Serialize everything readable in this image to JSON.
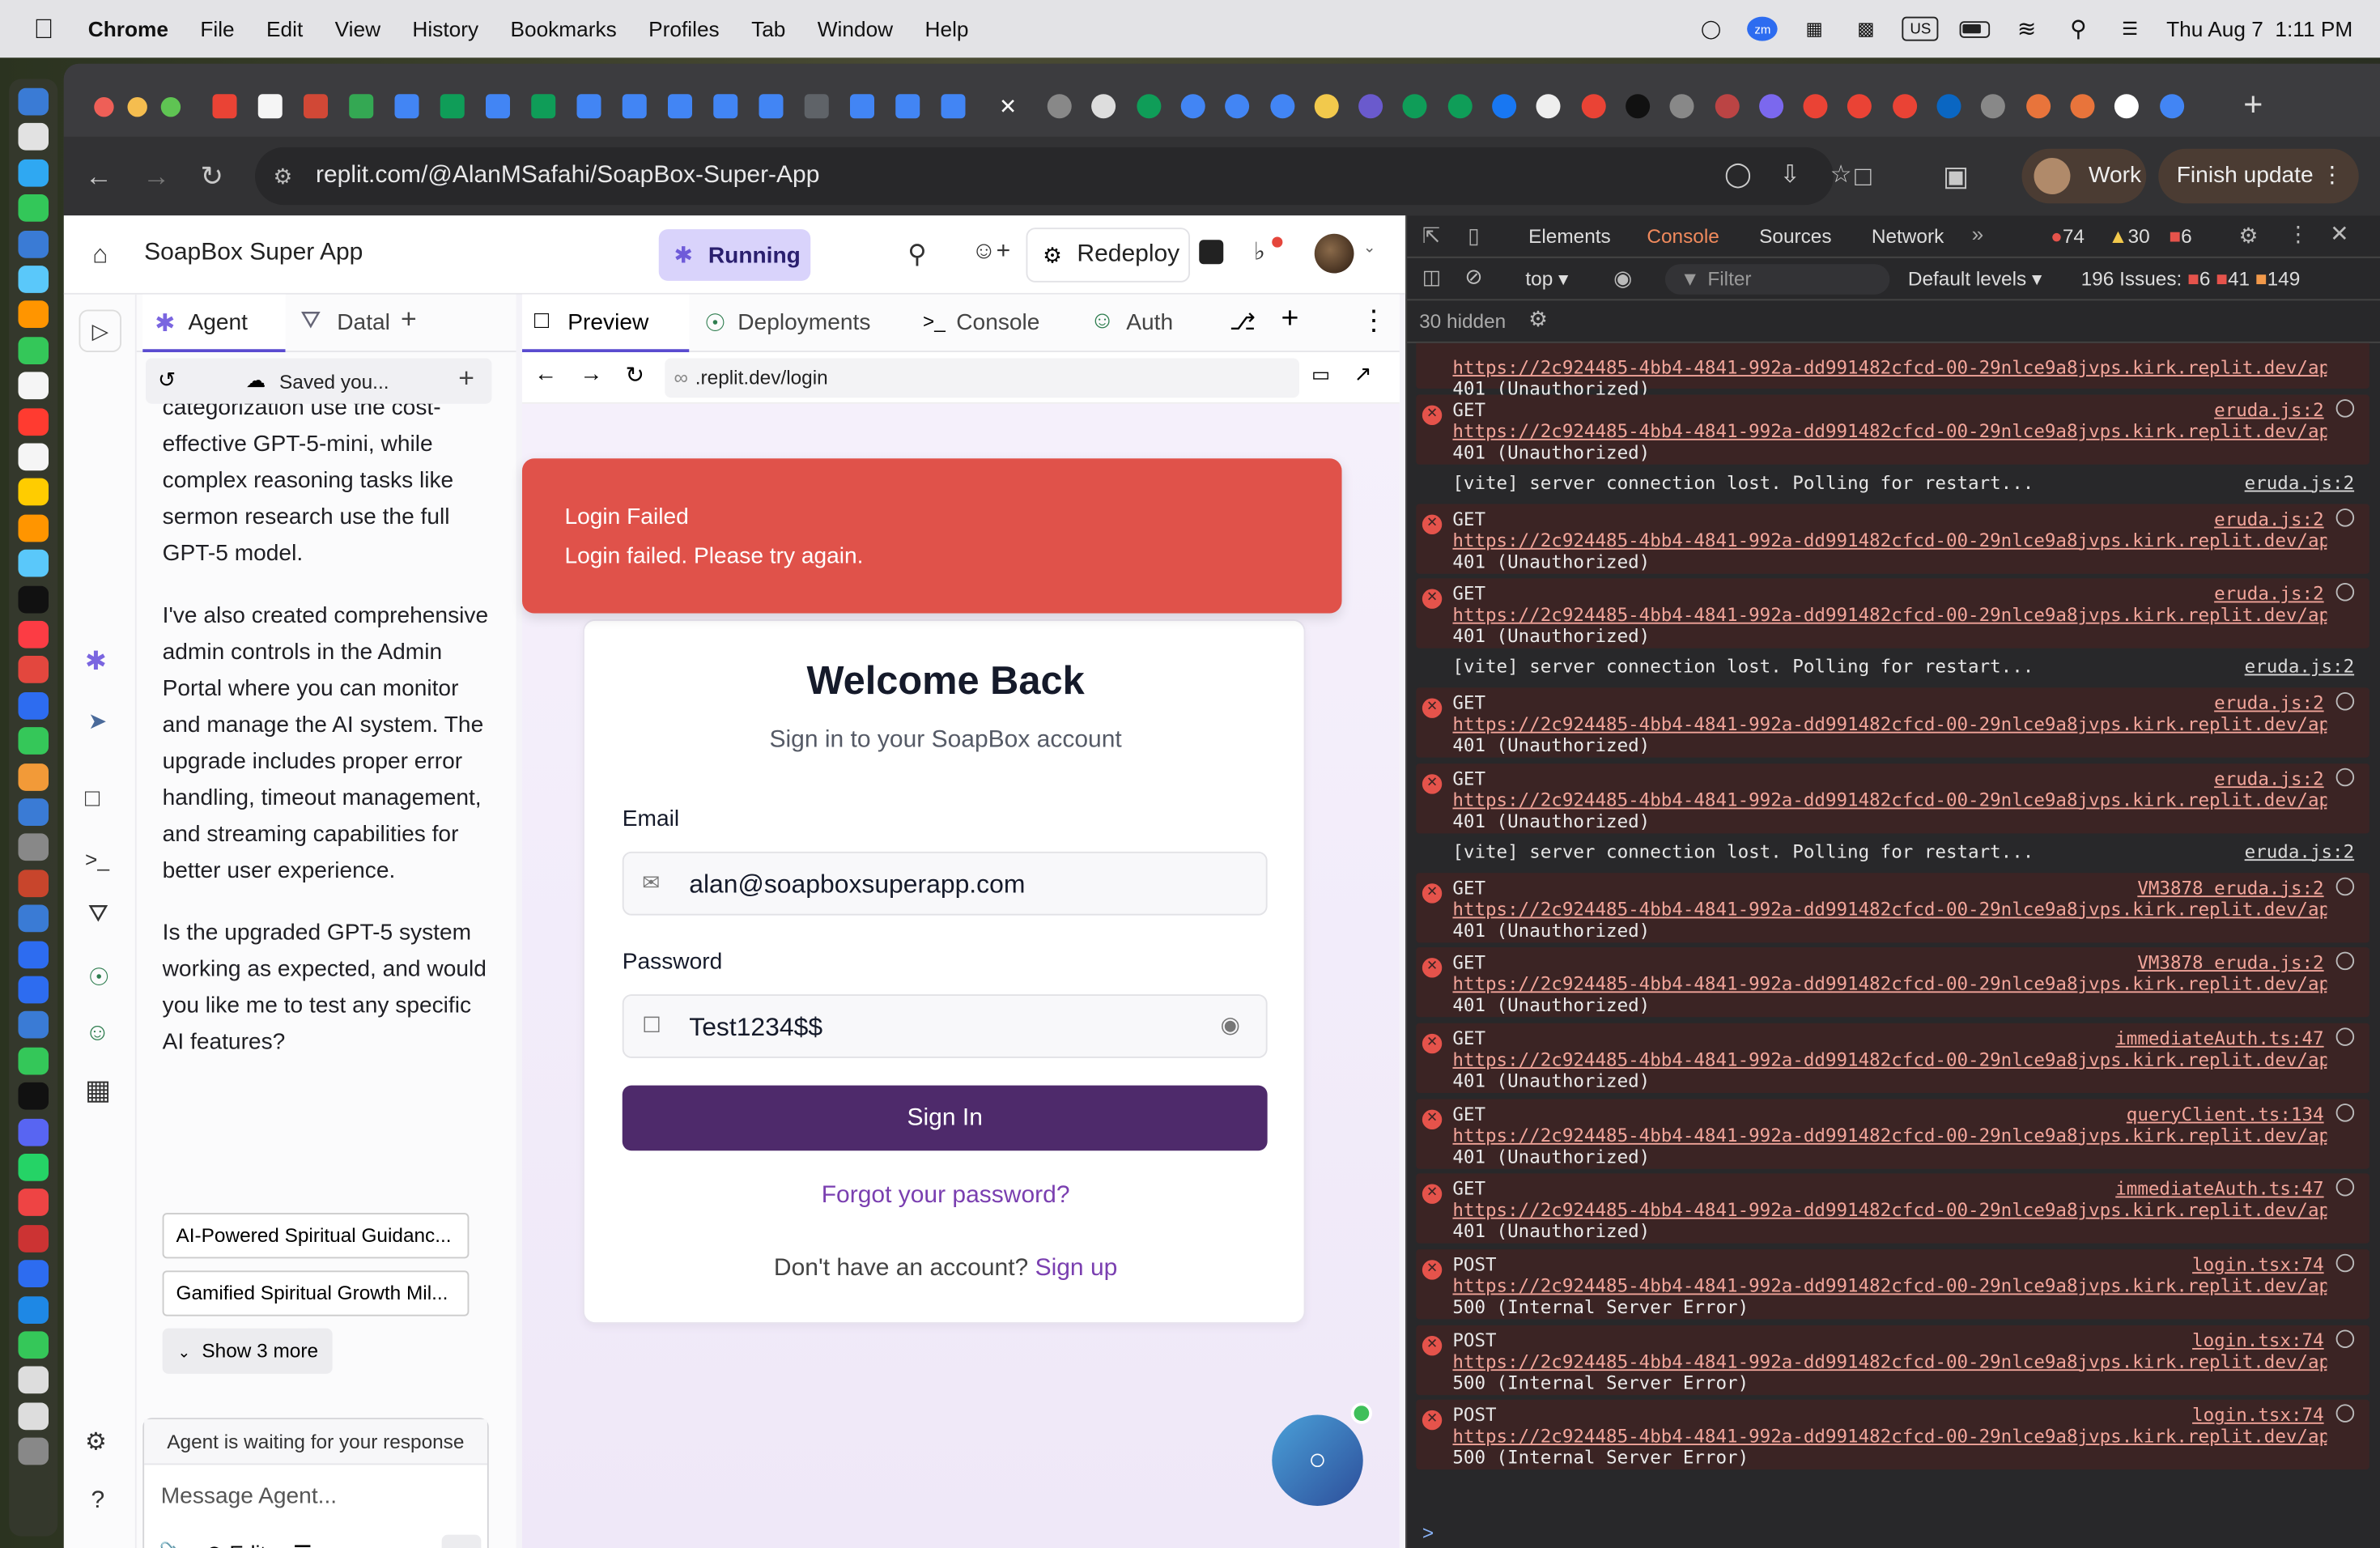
{
  "menubar": {
    "app": "Chrome",
    "items": [
      "File",
      "Edit",
      "View",
      "History",
      "Bookmarks",
      "Profiles",
      "Tab",
      "Window",
      "Help"
    ],
    "datetime": "Thu Aug 7  1:11 PM",
    "input_source": "US"
  },
  "browser": {
    "url": "replit.com/@AlanMSafahi/SoapBox-Super-App",
    "profile_label": "Work",
    "finish_update": "Finish update"
  },
  "replit": {
    "app_title": "SoapBox Super App",
    "running_label": "Running",
    "redeploy_label": "Redeploy",
    "left_tabs": {
      "agent": "Agent",
      "data": "Datal"
    },
    "right_tabs": {
      "preview": "Preview",
      "deployments": "Deployments",
      "console": "Console",
      "auth": "Auth"
    },
    "history_label": "Saved you...",
    "chat": {
      "para1": "categorization use the cost-effective GPT-5-mini, while complex reasoning tasks like sermon research use the full GPT-5 model.",
      "para2": "I've also created comprehensive admin controls in the Admin Portal where you can monitor and manage the AI system. The upgrade includes proper error handling, timeout management, and streaming capabilities for better user experience.",
      "para3": "Is the upgraded GPT-5 system working as expected, and would you like me to test any specific AI features?",
      "chips": [
        "AI-Powered Spiritual Guidanc...",
        "Gamified Spiritual Growth Mil..."
      ],
      "show_more": "Show 3 more",
      "waiting": "Agent is waiting for your response",
      "placeholder": "Message Agent...",
      "edit_label": "Edit"
    },
    "preview": {
      "address": ".replit.dev/login",
      "toast_title": "Login Failed",
      "toast_body": "Login failed. Please try again.",
      "card_title": "Welcome Back",
      "card_subtitle": "Sign in to your SoapBox account",
      "email_label": "Email",
      "email_value": "alan@soapboxsuperapp.com",
      "password_label": "Password",
      "password_value": "Test1234$$",
      "sign_in": "Sign In",
      "forgot": "Forgot your password?",
      "no_account": "Don't have an account?",
      "sign_up": "Sign up"
    }
  },
  "devtools": {
    "tabs": [
      "Elements",
      "Console",
      "Sources",
      "Network"
    ],
    "errors": "74",
    "warnings": "30",
    "info": "6",
    "context": "top",
    "filter_placeholder": "Filter",
    "levels": "Default levels",
    "issues_label": "196 Issues:",
    "issue_errors": "6",
    "issue_warnings": "41",
    "issue_info": "149",
    "hidden": "30 hidden",
    "url": "https://2c924485-4bb4-4841-992a-dd991482cfcd-00-29nlce9a8jvps.kirk.replit.dev/ap…",
    "logs": [
      {
        "kind": "err",
        "method": "GET",
        "src": "eruda.js:2",
        "status": "401 (Unauthorized)"
      },
      {
        "kind": "msg",
        "text": "[vite] server connection lost. Polling for restart...",
        "src": "eruda.js:2"
      },
      {
        "kind": "err",
        "method": "GET",
        "src": "eruda.js:2",
        "status": "401 (Unauthorized)"
      },
      {
        "kind": "err",
        "method": "GET",
        "src": "eruda.js:2",
        "status": "401 (Unauthorized)"
      },
      {
        "kind": "msg",
        "text": "[vite] server connection lost. Polling for restart...",
        "src": "eruda.js:2"
      },
      {
        "kind": "err",
        "method": "GET",
        "src": "eruda.js:2",
        "status": "401 (Unauthorized)"
      },
      {
        "kind": "err",
        "method": "GET",
        "src": "eruda.js:2",
        "status": "401 (Unauthorized)"
      },
      {
        "kind": "msg",
        "text": "[vite] server connection lost. Polling for restart...",
        "src": "eruda.js:2"
      },
      {
        "kind": "err",
        "method": "GET",
        "src": "VM3878 eruda.js:2",
        "status": "401 (Unauthorized)"
      },
      {
        "kind": "err",
        "method": "GET",
        "src": "VM3878 eruda.js:2",
        "status": "401 (Unauthorized)"
      },
      {
        "kind": "err",
        "method": "GET",
        "src": "immediateAuth.ts:47",
        "status": "401 (Unauthorized)"
      },
      {
        "kind": "err",
        "method": "GET",
        "src": "queryClient.ts:134",
        "status": "401 (Unauthorized)"
      },
      {
        "kind": "err",
        "method": "GET",
        "src": "immediateAuth.ts:47",
        "status": "401 (Unauthorized)"
      },
      {
        "kind": "err",
        "method": "POST",
        "src": "login.tsx:74",
        "status": "500 (Internal Server Error)"
      },
      {
        "kind": "err",
        "method": "POST",
        "src": "login.tsx:74",
        "status": "500 (Internal Server Error)"
      },
      {
        "kind": "err",
        "method": "POST",
        "src": "login.tsx:74",
        "status": "500 (Internal Server Error)"
      }
    ],
    "prompt": ">"
  }
}
